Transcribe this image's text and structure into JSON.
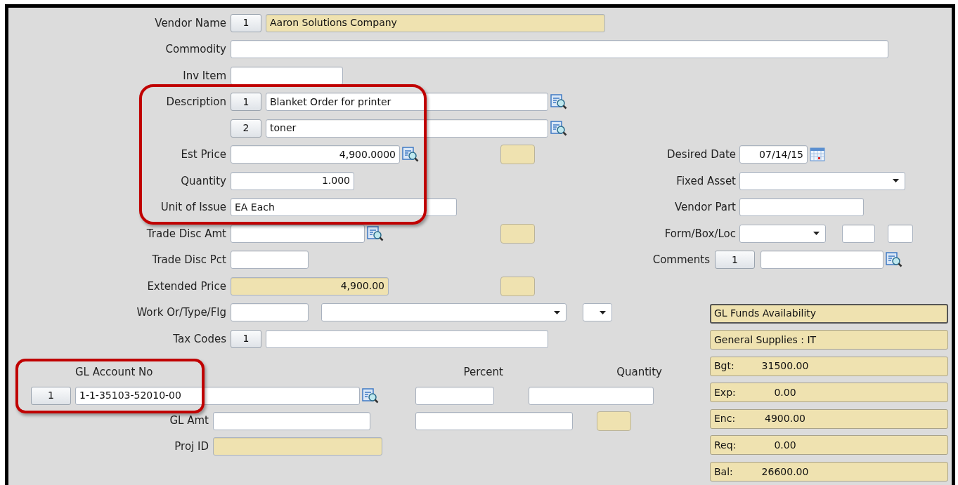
{
  "form": {
    "vendor_name": {
      "label": "Vendor Name",
      "counter": "1",
      "value": "Aaron Solutions Company",
      "readonly": true
    },
    "commodity": {
      "label": "Commodity"
    },
    "inv_item": {
      "label": "Inv Item"
    },
    "description": {
      "label": "Description",
      "lines": [
        {
          "counter": "1",
          "value": "Blanket Order for printer"
        },
        {
          "counter": "2",
          "value": "toner"
        }
      ]
    },
    "est_price": {
      "label": "Est Price",
      "value": "4,900.0000"
    },
    "quantity": {
      "label": "Quantity",
      "value": "1.000"
    },
    "unit_of_issue": {
      "label": "Unit of Issue",
      "value": "EA Each"
    },
    "trade_disc_amt": {
      "label": "Trade Disc Amt"
    },
    "trade_disc_pct": {
      "label": "Trade Disc Pct"
    },
    "extended_price": {
      "label": "Extended Price",
      "value": "4,900.00",
      "readonly": true
    },
    "work_order": {
      "label": "Work Or/Type/Flg"
    },
    "tax_codes": {
      "label": "Tax Codes",
      "counter": "1"
    },
    "desired_date": {
      "label": "Desired Date",
      "value": "07/14/15"
    },
    "fixed_asset": {
      "label": "Fixed Asset"
    },
    "vendor_part": {
      "label": "Vendor Part"
    },
    "form_box_loc": {
      "label": "Form/Box/Loc"
    },
    "comments": {
      "label": "Comments",
      "counter": "1"
    }
  },
  "gl": {
    "account_heading": "GL Account No",
    "percent_heading": "Percent",
    "quantity_heading": "Quantity",
    "counter": "1",
    "account": "1-1-35103-52010-00",
    "amt_label": "GL Amt",
    "proj_label": "Proj ID",
    "proj_readonly": true
  },
  "funds": {
    "title": "GL Funds Availability",
    "account_name": "General Supplies : IT",
    "lines": [
      {
        "label": "Bgt:",
        "value": "31500.00"
      },
      {
        "label": "Exp:",
        "value": "0.00"
      },
      {
        "label": "Enc:",
        "value": "4900.00"
      },
      {
        "label": "Req:",
        "value": "0.00"
      },
      {
        "label": "Bal:",
        "value": "26600.00"
      }
    ]
  }
}
